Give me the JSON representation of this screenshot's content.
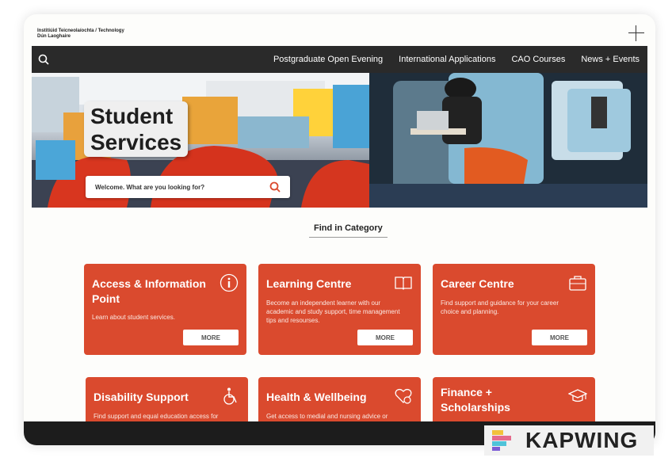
{
  "header": {
    "institute_line1": "Institiúid Teicneolaíochta / Technology",
    "institute_line2": "Dún Laoghaire"
  },
  "nav": {
    "links": [
      "Postgraduate Open Evening",
      "International Applications",
      "CAO Courses",
      "News + Events"
    ]
  },
  "hero": {
    "title_line1": "Student",
    "title_line2": "Services",
    "search_placeholder": "Welcome. What are you looking for?"
  },
  "section": {
    "heading": "Find in Category"
  },
  "cards": [
    {
      "title": "Access & Information Point",
      "desc": "Learn about student services.",
      "more": "MORE",
      "icon": "info-icon"
    },
    {
      "title": "Learning Centre",
      "desc": "Become an independent learner with our academic and study support, time management tips and resourses.",
      "more": "MORE",
      "icon": "book-icon"
    },
    {
      "title": "Career Centre",
      "desc": "Find support and guidance for your career choice and planning.",
      "more": "MORE",
      "icon": "briefcase-icon"
    },
    {
      "title": "Disability Support",
      "desc": "Find support and equal education access for",
      "icon": "wheelchair-icon"
    },
    {
      "title": "Health & Wellbeing",
      "desc": "Get access to medial and nursing advice or",
      "icon": "heart-icon"
    },
    {
      "title": "Finance + Scholarships",
      "desc": "",
      "icon": "graduation-cap-icon"
    }
  ],
  "watermark": {
    "text": "KAPWING"
  },
  "colors": {
    "card": "#da4a2e",
    "nav": "#2a2a2a"
  }
}
